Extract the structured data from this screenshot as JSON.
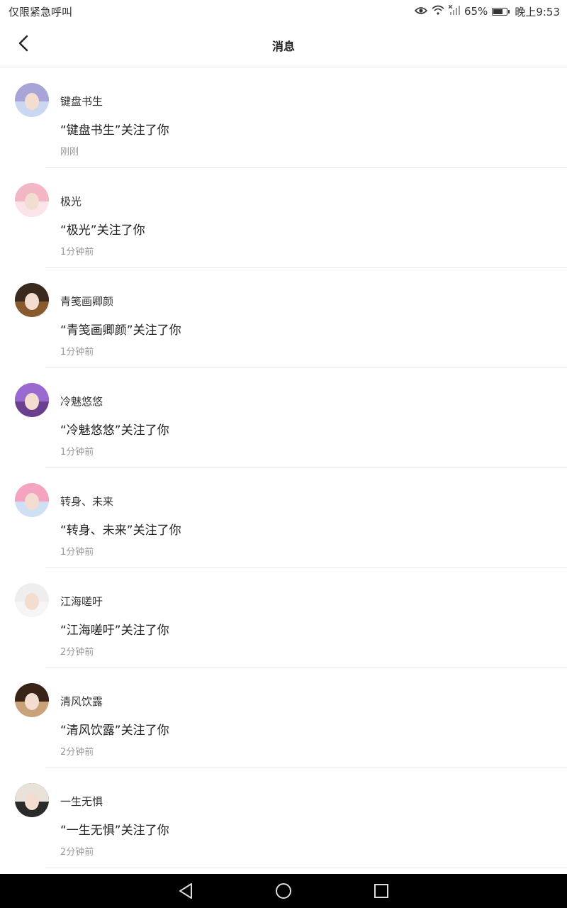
{
  "status_bar": {
    "carrier": "仅限紧急呼叫",
    "battery_text": "65%",
    "battery_level": 0.65,
    "time": "晚上9:53",
    "icons": [
      "eye-icon",
      "wifi-icon",
      "no-signal-icon",
      "battery-icon"
    ]
  },
  "header": {
    "title": "消息",
    "back_icon": "chevron-left-icon"
  },
  "notifications": [
    {
      "name": "键盘书生",
      "message": "“键盘书生”关注了你",
      "time": "刚刚",
      "hair": "#a9a4d8",
      "bg": "#c9d8f0"
    },
    {
      "name": "极光",
      "message": "“极光”关注了你",
      "time": "1分钟前",
      "hair": "#f2b6c4",
      "bg": "#fbe3ea"
    },
    {
      "name": "青笺画卿颜",
      "message": "“青笺画卿颜”关注了你",
      "time": "1分钟前",
      "hair": "#3b2a20",
      "bg": "#8a5a2f"
    },
    {
      "name": "冷魅悠悠",
      "message": "“冷魅悠悠”关注了你",
      "time": "1分钟前",
      "hair": "#9b6ad0",
      "bg": "#6b3f8f"
    },
    {
      "name": "转身、未来",
      "message": "“转身、未来”关注了你",
      "time": "1分钟前",
      "hair": "#f4a3c0",
      "bg": "#cfe0f5"
    },
    {
      "name": "江海嗟吁",
      "message": "“江海嗟吁”关注了你",
      "time": "2分钟前",
      "hair": "#eeeeee",
      "bg": "#f5f5f5"
    },
    {
      "name": "清风饮露",
      "message": "“清风饮露”关注了你",
      "time": "2分钟前",
      "hair": "#3a2418",
      "bg": "#c9a27a"
    },
    {
      "name": "一生无惧",
      "message": "“一生无惧”关注了你",
      "time": "2分钟前",
      "hair": "#e8e2d8",
      "bg": "#2a2a2a"
    }
  ],
  "nav_bar": {
    "icons": [
      "back-triangle-icon",
      "home-circle-icon",
      "recents-square-icon"
    ]
  }
}
